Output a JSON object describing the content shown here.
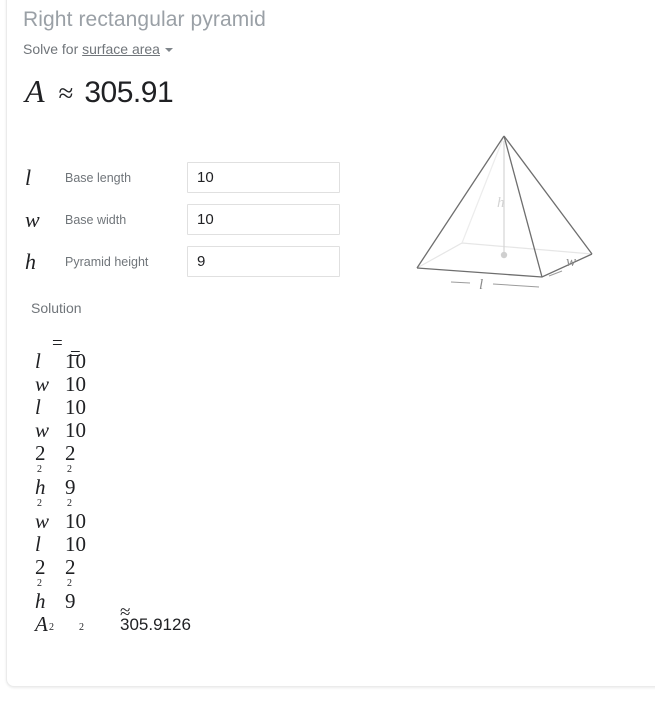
{
  "card": {
    "title": "Right rectangular pyramid",
    "solve_for_label": "Solve for",
    "solve_for_target": "surface area",
    "caret_icon": "chevron-down-icon"
  },
  "result": {
    "symbol": "A",
    "relation": "≈",
    "value": "305.91"
  },
  "fields": [
    {
      "symbol": "l",
      "label": "Base length",
      "value": "10",
      "placeholder": ""
    },
    {
      "symbol": "w",
      "label": "Base width",
      "value": "10",
      "placeholder": ""
    },
    {
      "symbol": "h",
      "label": "Pyramid height",
      "value": "9",
      "placeholder": ""
    }
  ],
  "diagram": {
    "name": "right-rectangular-pyramid-diagram",
    "labels": {
      "length": "l",
      "width": "w",
      "height": "h"
    },
    "edge_color": "#6e6e6e",
    "hidden_edge_color": "#e2e2e2",
    "height_line_color": "#cfcfcf"
  },
  "solution": {
    "label": "Solution",
    "stray_equals": [
      "=",
      "="
    ],
    "rows": [
      {
        "a": "l",
        "a_italic": true,
        "b": "10",
        "exp_a": "",
        "exp_b": ""
      },
      {
        "a": "w",
        "a_italic": true,
        "b": "10",
        "exp_a": "",
        "exp_b": ""
      },
      {
        "a": "l",
        "a_italic": true,
        "b": "10",
        "exp_a": "",
        "exp_b": ""
      },
      {
        "a": "w",
        "a_italic": true,
        "b": "10",
        "exp_a": "",
        "exp_b": ""
      },
      {
        "a": "2",
        "a_italic": false,
        "b": "2",
        "exp_a": "2",
        "exp_b": "2"
      },
      {
        "a": "h",
        "a_italic": true,
        "b": "9",
        "exp_a": "2",
        "exp_b": "2"
      },
      {
        "a": "w",
        "a_italic": true,
        "b": "10",
        "exp_a": "",
        "exp_b": ""
      },
      {
        "a": "l",
        "a_italic": true,
        "b": "10",
        "exp_a": "",
        "exp_b": ""
      },
      {
        "a": "2",
        "a_italic": false,
        "b": "2",
        "exp_a": "2",
        "exp_b": "2"
      },
      {
        "a": "h",
        "a_italic": true,
        "b": "9",
        "exp_a": "",
        "exp_b": ""
      }
    ],
    "final": {
      "symbol": "A",
      "sub_a": "2",
      "sub_b": "2",
      "relation": "≈",
      "value": "305.9126"
    }
  }
}
